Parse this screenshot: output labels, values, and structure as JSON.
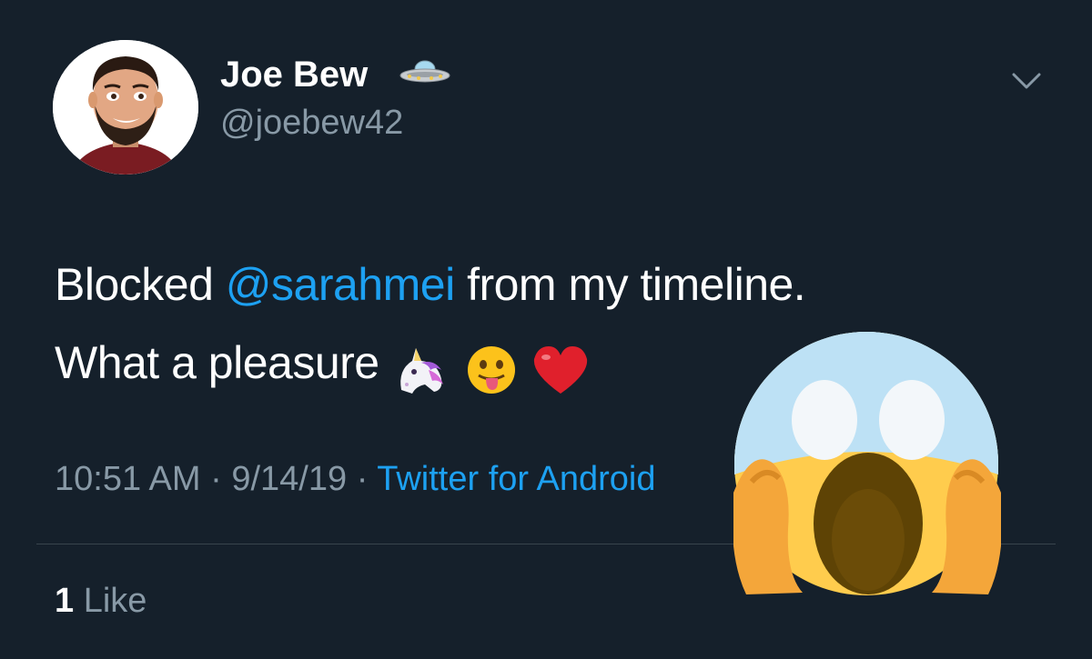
{
  "tweet": {
    "author": {
      "display_name": "Joe Bew",
      "handle": "@joebew42",
      "name_icon": "flying-saucer-icon"
    },
    "menu_icon": "chevron-down-icon",
    "text": {
      "prefix": "Blocked ",
      "mention": "@sarahmei",
      "suffix": " from my timeline.",
      "line2": "What a pleasure",
      "emojis": [
        "unicorn-icon",
        "tongue-face-icon",
        "red-heart-icon"
      ]
    },
    "meta": {
      "time": "10:51 AM",
      "separator": "·",
      "date": "9/14/19",
      "source": "Twitter for Andr",
      "source_hidden_tail": "oid"
    },
    "likes": {
      "count": "1",
      "label": "Like"
    }
  },
  "overlay": {
    "icon": "screaming-face-emoji-icon"
  },
  "colors": {
    "background": "#15202b",
    "text_primary": "#ffffff",
    "text_secondary": "#8899a6",
    "accent": "#1da1f2",
    "divider": "#38444d"
  }
}
